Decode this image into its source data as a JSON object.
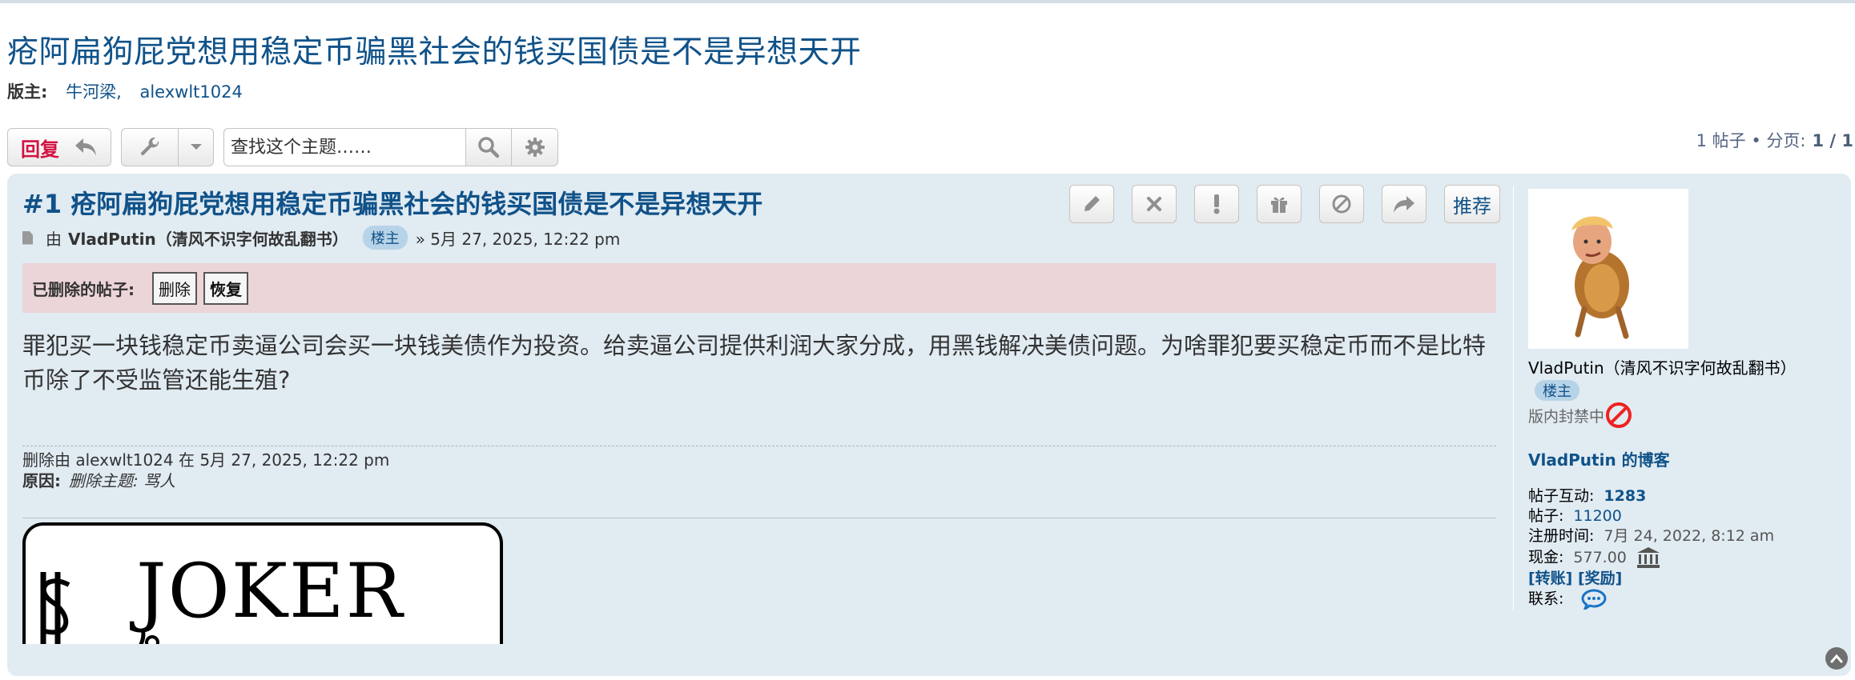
{
  "topic": {
    "title": "疮阿扁狗屁党想用稳定币骗黑社会的钱买国债是不是异想天开",
    "moderators_label": "版主:",
    "moderators": [
      "牛河梁,",
      "alexwlt1024"
    ]
  },
  "toolbar": {
    "reply_label": "回复",
    "search_placeholder": "查找这个主题……"
  },
  "pagination": {
    "summary": "1 帖子 • 分页:",
    "page": "1 / 1"
  },
  "post": {
    "title": "#1 疮阿扁狗屁党想用稳定币骗黑社会的钱买国债是不是异想天开",
    "buttons": {
      "recommend_label": "推荐"
    },
    "meta": {
      "by": "由",
      "author": "VladPutin（清风不识字何故乱翻书）",
      "badge": "楼主",
      "date": "» 5月 27, 2025, 12:22 pm"
    },
    "deleted_bar": {
      "label": "已删除的帖子:",
      "delete_label": "删除",
      "restore_label": "恢复"
    },
    "content": "罪犯买一块钱稳定币卖逼公司会买一块钱美债作为投资。给卖逼公司提供利润大家分成，用黑钱解决美债问题。为啥罪犯要买稳定币而不是比特币除了不受监管还能生殖?",
    "deletion_notice": {
      "line": "删除由 alexwlt1024 在 5月 27, 2025, 12:22 pm",
      "reason_label": "原因:",
      "reason": "删除主题: 骂人"
    },
    "signature_text": "JOKER"
  },
  "profile": {
    "username": "VladPutin（清风不识字何故乱翻书）",
    "rank": "楼主",
    "banned_text": "版内封禁中",
    "blog_link": "VladPutin 的博客",
    "interactions_label": "帖子互动:",
    "interactions": "1283",
    "posts_label": "帖子:",
    "posts": "11200",
    "joined_label": "注册时间:",
    "joined": "7月 24, 2022, 8:12 am",
    "cash_label": "现金:",
    "cash": "577.00",
    "transfer_link": "[转账]",
    "reward_link": "[奖励]",
    "contact_label": "联系:"
  },
  "colors": {
    "link": "#105289",
    "reply": "#d31141",
    "post_bg": "#e1ebf2",
    "deleted_bg": "#ecd5d8",
    "badge_bg": "#b7d3e7"
  },
  "icons": [
    "reply-arrow-icon",
    "wrench-icon",
    "chevron-down-icon",
    "search-icon",
    "gear-icon",
    "pencil-icon",
    "close-icon",
    "exclamation-icon",
    "gift-icon",
    "ban-circle-icon",
    "share-icon",
    "file-icon",
    "bank-icon",
    "chat-icon",
    "arrow-up-icon"
  ]
}
